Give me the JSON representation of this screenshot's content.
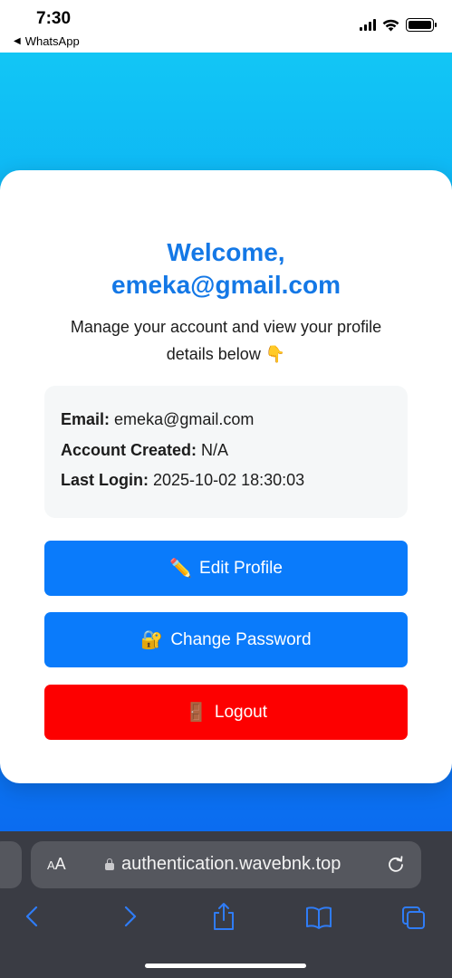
{
  "status_bar": {
    "time": "7:30",
    "back_app": "WhatsApp"
  },
  "card": {
    "welcome_line1": "Welcome,",
    "welcome_line2": "emeka@gmail.com",
    "subtitle": "Manage your account and view your profile details below 👇",
    "info": [
      {
        "label": "Email:",
        "value": "emeka@gmail.com"
      },
      {
        "label": "Account Created:",
        "value": "N/A"
      },
      {
        "label": "Last Login:",
        "value": "2025-10-02 18:30:03"
      }
    ],
    "buttons": {
      "edit_icon": "✏️",
      "edit_label": "Edit Profile",
      "password_icon": "🔐",
      "password_label": "Change Password",
      "logout_icon": "🚪",
      "logout_label": "Logout"
    }
  },
  "safari": {
    "text_size_small": "A",
    "text_size_large": "A",
    "url": "authentication.wavebnk.top",
    "icons": [
      "text-size-icon",
      "lock-icon",
      "reload-icon",
      "back-icon",
      "forward-icon",
      "share-icon",
      "bookmarks-icon",
      "tabs-icon"
    ]
  },
  "colors": {
    "accent": "#1478e6",
    "button_blue": "#0a7bfb",
    "button_red": "#fd0000",
    "background_top": "#12c6f5",
    "background_bottom": "#0b6cf0"
  }
}
